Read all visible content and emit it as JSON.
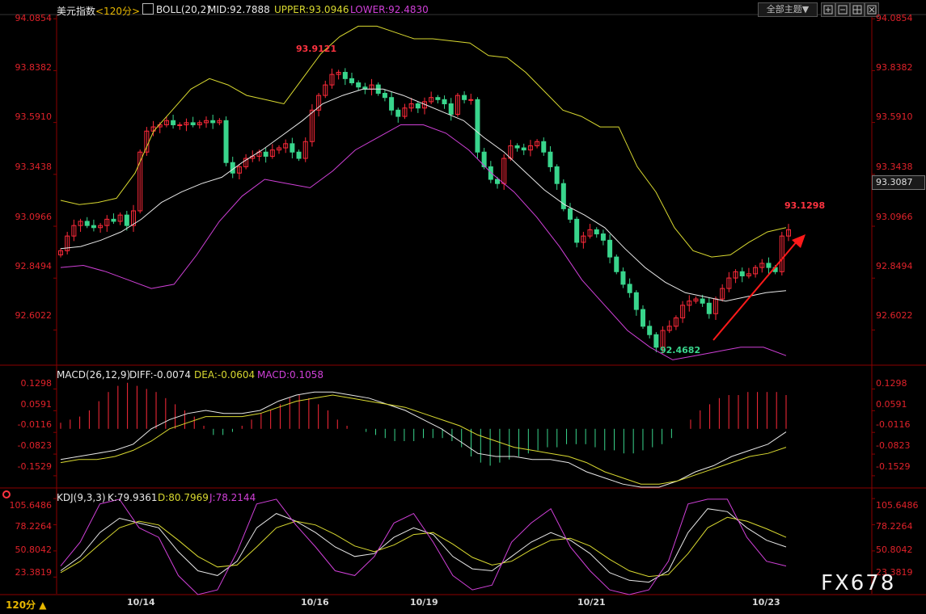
{
  "window": {
    "title": "美元指数",
    "period_title": "<120分>",
    "period_selector": "120分",
    "period_arrow": "▲"
  },
  "controls": {
    "theme_button": "全部主题▼"
  },
  "boll": {
    "label": "BOLL(20,2)",
    "mid": "MID:92.7888",
    "upper": "UPPER:93.0946",
    "lower": "LOWER:92.4830"
  },
  "macd": {
    "label": "MACD(26,12,9)",
    "diff": "DIFF:-0.0074",
    "dea": "DEA:-0.0604",
    "macd": "MACD:0.1058"
  },
  "kdj": {
    "label": "KDJ(9,3,3)",
    "k": "K:79.9361",
    "d": "D:80.7969",
    "j": "J:78.2144"
  },
  "price_axis": [
    "94.0854",
    "93.8382",
    "93.5910",
    "93.3438",
    "93.0966",
    "92.8494",
    "92.6022"
  ],
  "current_price": "93.3087",
  "macd_axis": [
    "0.1298",
    "0.0591",
    "-0.0116",
    "-0.0823",
    "-0.1529"
  ],
  "kdj_axis": [
    "105.6486",
    "78.2264",
    "50.8042",
    "23.3819"
  ],
  "dates": [
    "10/14",
    "10/16",
    "10/19",
    "10/21",
    "10/23"
  ],
  "annotations": {
    "high": "93.9121",
    "low": "92.4682",
    "recent_high": "93.1298"
  },
  "watermark": "FX678",
  "colors": {
    "up": "#ff2a3a",
    "down": "#39d58c",
    "upper": "#d9d930",
    "mid": "#e8e8e8",
    "lower": "#d040d8",
    "axis": "#e0222a",
    "grid": "#8b0000"
  },
  "icons": [
    "theme-menu-icon",
    "zoom-in-icon",
    "zoom-out-icon",
    "layout-icon",
    "close-icon",
    "boll-toggle-icon",
    "kdj-marker-icon",
    "trend-arrow"
  ],
  "chart_data": [
    {
      "type": "candlestick",
      "title": "美元指数 <120分>",
      "x": [
        "10/14",
        "10/16",
        "10/19",
        "10/21",
        "10/23"
      ],
      "ylim": [
        92.45,
        94.09
      ],
      "indicators": [
        "BOLL(20,2)"
      ],
      "series": [
        {
          "name": "price",
          "values": [
            92.98,
            93.05,
            93.1,
            93.12,
            93.1,
            93.09,
            93.1,
            93.13,
            93.12,
            93.15,
            93.1,
            93.17,
            93.45,
            93.55,
            93.57,
            93.58,
            93.6,
            93.58,
            93.58,
            93.59,
            93.58,
            93.59,
            93.6,
            93.59,
            93.6,
            93.4,
            93.35,
            93.38,
            93.42,
            93.43,
            93.45,
            93.43,
            93.46,
            93.47,
            93.49,
            93.45,
            93.42,
            93.5,
            93.65,
            93.72,
            93.77,
            93.82,
            93.83,
            93.8,
            93.78,
            93.76,
            93.75,
            93.77,
            93.73,
            93.71,
            93.65,
            93.62,
            93.66,
            93.68,
            93.66,
            93.69,
            93.71,
            93.7,
            93.68,
            93.63,
            93.72,
            93.7,
            93.7,
            93.45,
            93.38,
            93.32,
            93.3,
            93.42,
            93.48,
            93.47,
            93.46,
            93.48,
            93.5,
            93.45,
            93.38,
            93.3,
            93.18,
            93.13,
            93.02,
            93.05,
            93.08,
            93.06,
            93.03,
            92.95,
            92.88,
            92.82,
            92.78,
            92.7,
            92.62,
            92.58,
            92.52,
            92.6,
            92.62,
            92.66,
            92.72,
            92.74,
            92.75,
            92.73,
            92.68,
            92.75,
            92.8,
            92.85,
            92.88,
            92.86,
            92.87,
            92.9,
            92.92,
            92.9,
            92.88,
            93.05,
            93.08
          ]
        },
        {
          "name": "UPPER",
          "values": [
            93.22,
            93.2,
            93.21,
            93.23,
            93.35,
            93.55,
            93.65,
            93.75,
            93.8,
            93.77,
            93.72,
            93.7,
            93.68,
            93.8,
            93.92,
            94.0,
            94.05,
            94.05,
            94.02,
            93.99,
            93.99,
            93.98,
            93.97,
            93.91,
            93.9,
            93.83,
            93.74,
            93.65,
            93.62,
            93.57,
            93.57,
            93.38,
            93.26,
            93.09,
            92.98,
            92.95,
            92.96,
            93.02,
            93.07,
            93.09
          ]
        },
        {
          "name": "MID",
          "values": [
            92.99,
            93.0,
            93.03,
            93.07,
            93.13,
            93.21,
            93.26,
            93.3,
            93.33,
            93.4,
            93.46,
            93.53,
            93.6,
            93.68,
            93.72,
            93.75,
            93.75,
            93.72,
            93.68,
            93.64,
            93.6,
            93.52,
            93.45,
            93.36,
            93.27,
            93.2,
            93.15,
            93.09,
            92.99,
            92.9,
            92.83,
            92.78,
            92.76,
            92.74,
            92.76,
            92.78,
            92.79
          ]
        },
        {
          "name": "LOWER",
          "values": [
            92.9,
            92.91,
            92.88,
            92.84,
            92.8,
            92.82,
            92.96,
            93.12,
            93.24,
            93.32,
            93.3,
            93.28,
            93.36,
            93.46,
            93.52,
            93.58,
            93.58,
            93.54,
            93.46,
            93.35,
            93.26,
            93.14,
            93.0,
            92.84,
            92.72,
            92.6,
            92.52,
            92.46,
            92.48,
            92.5,
            92.52,
            92.52,
            92.48
          ]
        }
      ],
      "annotations": [
        "93.9121",
        "92.4682",
        "93.1298"
      ],
      "axis_ticks": [
        94.0854,
        93.8382,
        93.591,
        93.3438,
        93.0966,
        92.8494,
        92.6022
      ],
      "current": 93.3087
    },
    {
      "type": "bar",
      "title": "MACD(26,12,9)",
      "ylim": [
        -0.19,
        0.16
      ],
      "axis_ticks": [
        0.1298,
        0.0591,
        -0.0116,
        -0.0823,
        -0.1529
      ],
      "series": [
        {
          "name": "MACD",
          "values": [
            0.02,
            0.03,
            0.04,
            0.06,
            0.09,
            0.12,
            0.14,
            0.15,
            0.14,
            0.13,
            0.12,
            0.1,
            0.08,
            0.06,
            0.04,
            0.01,
            -0.02,
            -0.02,
            -0.01,
            0.01,
            0.03,
            0.05,
            0.06,
            0.08,
            0.1,
            0.11,
            0.1,
            0.08,
            0.06,
            0.03,
            0.01,
            0.0,
            -0.01,
            -0.02,
            -0.03,
            -0.04,
            -0.04,
            -0.04,
            -0.03,
            -0.03,
            -0.03,
            -0.04,
            -0.06,
            -0.09,
            -0.11,
            -0.12,
            -0.11,
            -0.1,
            -0.09,
            -0.08,
            -0.07,
            -0.06,
            -0.06,
            -0.05,
            -0.05,
            -0.05,
            -0.06,
            -0.07,
            -0.07,
            -0.08,
            -0.08,
            -0.07,
            -0.06,
            -0.05,
            -0.03,
            0.0,
            0.03,
            0.06,
            0.08,
            0.1,
            0.11,
            0.11,
            0.12,
            0.12,
            0.12,
            0.12,
            0.11
          ]
        },
        {
          "name": "DIFF",
          "values": [
            -0.1,
            -0.09,
            -0.08,
            -0.07,
            -0.05,
            0.0,
            0.03,
            0.05,
            0.06,
            0.05,
            0.05,
            0.06,
            0.09,
            0.11,
            0.12,
            0.12,
            0.11,
            0.1,
            0.08,
            0.06,
            0.03,
            0.0,
            -0.04,
            -0.08,
            -0.09,
            -0.09,
            -0.1,
            -0.1,
            -0.11,
            -0.14,
            -0.16,
            -0.18,
            -0.19,
            -0.19,
            -0.17,
            -0.14,
            -0.12,
            -0.09,
            -0.07,
            -0.05,
            -0.01
          ]
        },
        {
          "name": "DEA",
          "values": [
            -0.11,
            -0.1,
            -0.1,
            -0.09,
            -0.07,
            -0.04,
            0.0,
            0.02,
            0.04,
            0.04,
            0.04,
            0.05,
            0.07,
            0.09,
            0.1,
            0.11,
            0.1,
            0.09,
            0.08,
            0.07,
            0.05,
            0.03,
            0.01,
            -0.02,
            -0.04,
            -0.06,
            -0.07,
            -0.08,
            -0.09,
            -0.11,
            -0.14,
            -0.16,
            -0.18,
            -0.18,
            -0.17,
            -0.15,
            -0.13,
            -0.11,
            -0.09,
            -0.08,
            -0.06
          ]
        }
      ]
    },
    {
      "type": "line",
      "title": "KDJ(9,3,3)",
      "ylim": [
        5,
        110
      ],
      "axis_ticks": [
        105.6486,
        78.2264,
        50.8042,
        23.3819
      ],
      "series": [
        {
          "name": "K",
          "values": [
            30,
            45,
            70,
            85,
            80,
            75,
            50,
            30,
            25,
            40,
            75,
            90,
            82,
            70,
            55,
            45,
            48,
            65,
            75,
            68,
            45,
            32,
            30,
            45,
            60,
            70,
            62,
            48,
            28,
            20,
            18,
            30,
            70,
            95,
            92,
            75,
            62,
            55
          ]
        },
        {
          "name": "D",
          "values": [
            28,
            40,
            58,
            75,
            82,
            78,
            62,
            45,
            34,
            36,
            55,
            75,
            82,
            78,
            68,
            56,
            50,
            57,
            68,
            70,
            58,
            44,
            36,
            40,
            52,
            62,
            64,
            56,
            42,
            30,
            24,
            26,
            48,
            75,
            86,
            82,
            74,
            65
          ]
        },
        {
          "name": "J",
          "values": [
            35,
            60,
            100,
            105,
            75,
            65,
            25,
            5,
            10,
            50,
            100,
            105,
            78,
            55,
            30,
            25,
            45,
            80,
            90,
            60,
            25,
            10,
            15,
            60,
            80,
            95,
            55,
            30,
            10,
            5,
            10,
            40,
            100,
            105,
            105,
            65,
            40,
            35
          ]
        }
      ]
    }
  ]
}
